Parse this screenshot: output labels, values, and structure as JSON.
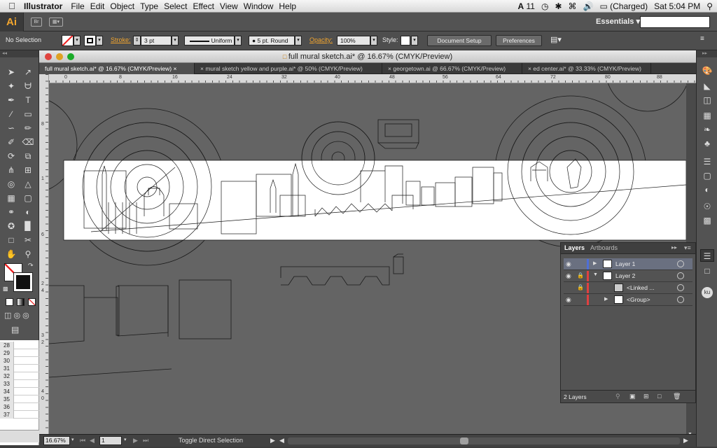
{
  "menubar": {
    "app": "Illustrator",
    "items": [
      "File",
      "Edit",
      "Object",
      "Type",
      "Select",
      "Effect",
      "View",
      "Window",
      "Help"
    ],
    "status": {
      "adobe": "11",
      "battery": "(Charged)",
      "clock": "Sat 5:04 PM"
    }
  },
  "appbar": {
    "logo": "Ai",
    "bridge": "Br",
    "workspace": "Essentials"
  },
  "control": {
    "selection": "No Selection",
    "stroke_label": "Stroke:",
    "stroke_value": "3 pt",
    "profile": "Uniform",
    "brush": "5 pt. Round",
    "opacity_label": "Opacity:",
    "opacity_value": "100%",
    "style_label": "Style:",
    "doc_setup": "Document Setup",
    "preferences": "Preferences"
  },
  "document": {
    "title": "full mural sketch.ai* @ 16.67% (CMYK/Preview)",
    "tabs": [
      "full mural sketch.ai* @ 16.67% (CMYK/Preview)",
      "mural sketch yellow and purple.ai* @ 50% (CMYK/Preview)",
      "georgetown.ai @ 66.67% (CMYK/Preview)",
      "ed center.ai* @ 33.33% (CMYK/Preview)"
    ],
    "hruler": [
      "0",
      "8",
      "16",
      "24",
      "32",
      "40",
      "48",
      "56",
      "64",
      "72",
      "80",
      "88"
    ],
    "vruler": [
      "8",
      "1",
      "6",
      "2",
      "4",
      "3",
      "2",
      "4",
      "0"
    ]
  },
  "status": {
    "zoom": "16.67%",
    "artboard": "1",
    "tool_hint": "Toggle Direct Selection"
  },
  "layers_panel": {
    "tabs": [
      "Layers",
      "Artboards"
    ],
    "rows": [
      {
        "name": "Layer 1",
        "color": "#4f6fd6"
      },
      {
        "name": "Layer 2",
        "color": "#e04040"
      },
      {
        "name": "<Linked ...",
        "color": "#e04040"
      },
      {
        "name": "<Group>",
        "color": "#e04040"
      }
    ],
    "footer": "2 Layers"
  },
  "sheet_rows": [
    "28",
    "29",
    "30",
    "31",
    "32",
    "33",
    "34",
    "35",
    "36",
    "37"
  ]
}
